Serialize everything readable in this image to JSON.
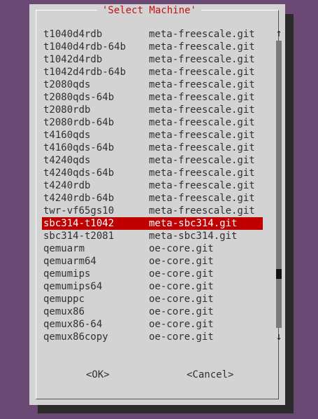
{
  "dialog": {
    "title": "'Select Machine'",
    "ok_label": "<OK>",
    "cancel_label": "<Cancel>"
  },
  "scroll": {
    "up_glyph": "↑",
    "down_glyph": "↓"
  },
  "machines": [
    {
      "name": "t1040d4rdb",
      "layer": "meta-freescale.git"
    },
    {
      "name": "t1040d4rdb-64b",
      "layer": "meta-freescale.git"
    },
    {
      "name": "t1042d4rdb",
      "layer": "meta-freescale.git"
    },
    {
      "name": "t1042d4rdb-64b",
      "layer": "meta-freescale.git"
    },
    {
      "name": "t2080qds",
      "layer": "meta-freescale.git"
    },
    {
      "name": "t2080qds-64b",
      "layer": "meta-freescale.git"
    },
    {
      "name": "t2080rdb",
      "layer": "meta-freescale.git"
    },
    {
      "name": "t2080rdb-64b",
      "layer": "meta-freescale.git"
    },
    {
      "name": "t4160qds",
      "layer": "meta-freescale.git"
    },
    {
      "name": "t4160qds-64b",
      "layer": "meta-freescale.git"
    },
    {
      "name": "t4240qds",
      "layer": "meta-freescale.git"
    },
    {
      "name": "t4240qds-64b",
      "layer": "meta-freescale.git"
    },
    {
      "name": "t4240rdb",
      "layer": "meta-freescale.git"
    },
    {
      "name": "t4240rdb-64b",
      "layer": "meta-freescale.git"
    },
    {
      "name": "twr-vf65gs10",
      "layer": "meta-freescale.git"
    },
    {
      "name": "sbc314-t1042",
      "layer": "meta-sbc314.git",
      "selected": true
    },
    {
      "name": "sbc314-t2081",
      "layer": "meta-sbc314.git"
    },
    {
      "name": "qemuarm",
      "layer": "oe-core.git"
    },
    {
      "name": "qemuarm64",
      "layer": "oe-core.git"
    },
    {
      "name": "qemumips",
      "layer": "oe-core.git"
    },
    {
      "name": "qemumips64",
      "layer": "oe-core.git"
    },
    {
      "name": "qemuppc",
      "layer": "oe-core.git"
    },
    {
      "name": "qemux86",
      "layer": "oe-core.git"
    },
    {
      "name": "qemux86-64",
      "layer": "oe-core.git"
    },
    {
      "name": "qemux86copy",
      "layer": "oe-core.git"
    }
  ],
  "colors": {
    "selection": "#c00000",
    "title": "#c41010",
    "desktop": "#6a4a75"
  }
}
